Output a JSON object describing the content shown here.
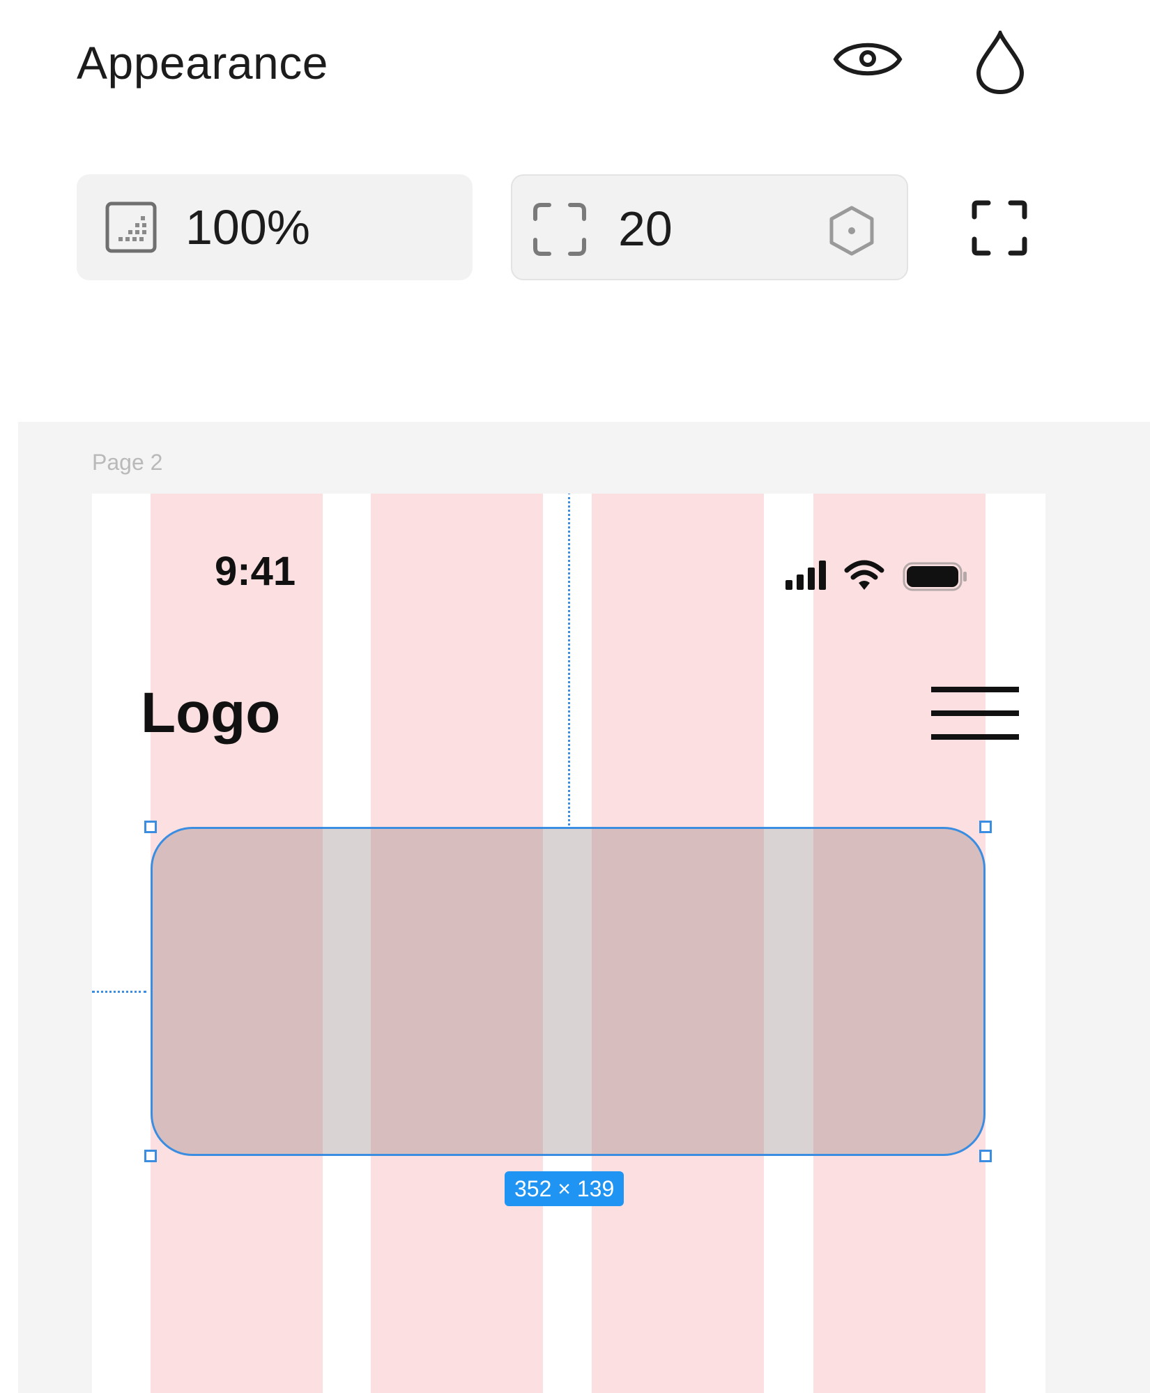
{
  "panel": {
    "title": "Appearance",
    "opacity": "100%",
    "corner_radius": "20",
    "icons": {
      "visibility": "eye-icon",
      "fill": "drop-icon",
      "opacity": "opacity-icon",
      "corner_radius": "corner-radius-icon",
      "radius_stepper": "hexagon-icon",
      "independent_corners": "independent-corners-icon"
    }
  },
  "canvas": {
    "page_label": "Page 2",
    "status_bar": {
      "time": "9:41",
      "icons": [
        "signal-icon",
        "wifi-icon",
        "battery-icon"
      ]
    },
    "header": {
      "logo": "Logo",
      "menu_icon": "hamburger-menu-icon"
    },
    "selection": {
      "size_label": "352 × 139"
    }
  },
  "colors": {
    "selection_blue": "#3a8de0",
    "badge_blue": "#1f94f2",
    "grid_column": "#fce0e1",
    "canvas_bg": "#f4f4f4"
  }
}
